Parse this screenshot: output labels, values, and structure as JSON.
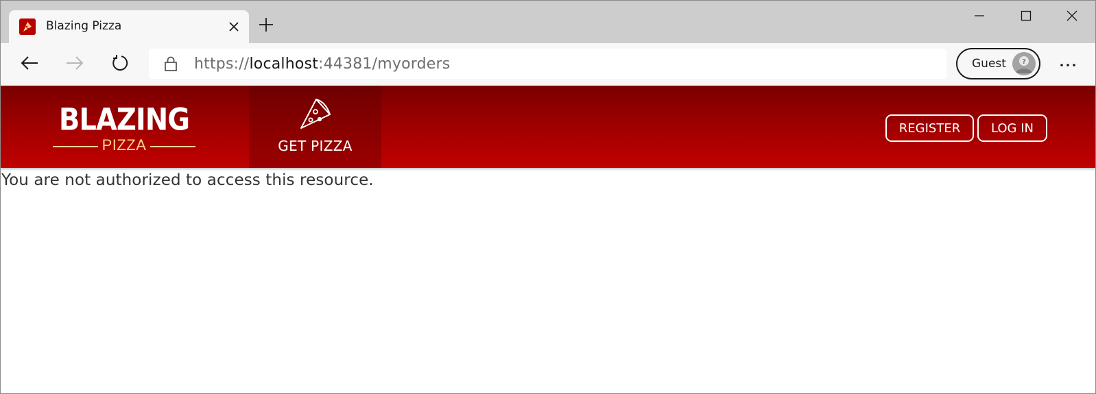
{
  "browser": {
    "tab": {
      "title": "Blazing Pizza",
      "favicon": "pizza-slice-icon"
    },
    "address": {
      "scheme": "https://",
      "host": "localhost",
      "rest": ":44381/myorders"
    },
    "profile": {
      "label": "Guest",
      "avatar": "unknown-user-icon"
    },
    "icons": {
      "back": "arrow-left-icon",
      "forward": "arrow-right-icon",
      "refresh": "refresh-icon",
      "lock": "lock-icon",
      "more": "more-horizontal-icon",
      "new_tab": "plus-icon",
      "close_tab": "close-icon",
      "minimize": "minimize-icon",
      "maximize": "maximize-icon",
      "close_window": "close-icon"
    }
  },
  "site": {
    "brand": {
      "main": "BLAZING",
      "sub": "PIZZA"
    },
    "nav": {
      "get_pizza": "GET PIZZA",
      "get_pizza_icon": "pizza-slice-icon"
    },
    "auth": {
      "register": "REGISTER",
      "login": "LOG IN"
    },
    "colors": {
      "header_top": "#7a0000",
      "header_bottom": "#c00000",
      "brand_accent": "#ffd28a"
    }
  },
  "content": {
    "message": "You are not authorized to access this resource."
  }
}
